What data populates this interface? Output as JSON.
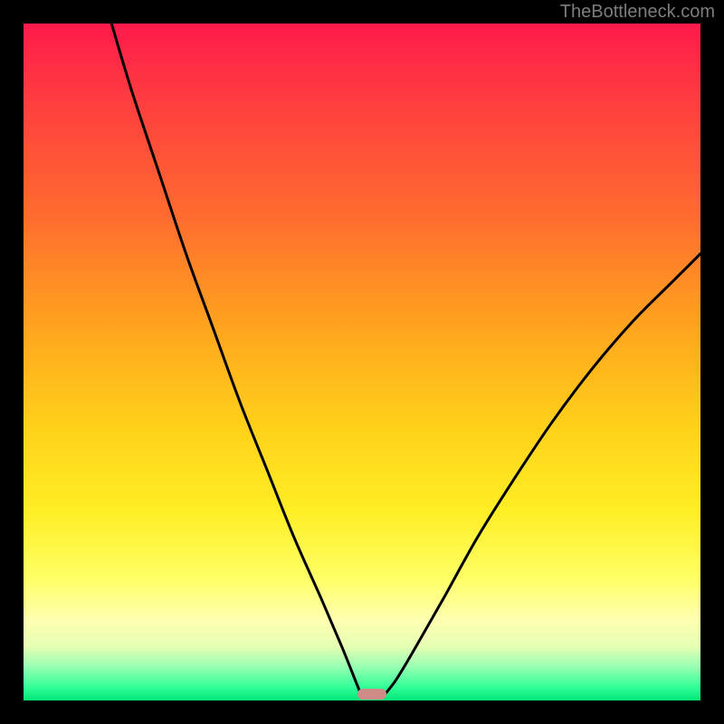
{
  "attribution": {
    "text": "TheBottleneck.com"
  },
  "chart_data": {
    "type": "line",
    "title": "",
    "xlabel": "",
    "ylabel": "",
    "xlim": [
      0,
      100
    ],
    "ylim": [
      0,
      100
    ],
    "grid": false,
    "series": [
      {
        "name": "left-branch",
        "x": [
          13.0,
          16.0,
          20.0,
          24.0,
          28.0,
          32.0,
          36.0,
          40.0,
          44.0,
          47.0,
          49.0,
          50.0
        ],
        "y": [
          100.0,
          90.0,
          78.0,
          66.0,
          55.0,
          44.0,
          34.0,
          24.0,
          15.0,
          8.0,
          3.0,
          0.5
        ]
      },
      {
        "name": "right-branch",
        "x": [
          53.0,
          55.0,
          58.0,
          62.0,
          67.0,
          72.0,
          78.0,
          84.0,
          90.0,
          96.0,
          100.0
        ],
        "y": [
          0.5,
          3.0,
          8.0,
          15.0,
          24.0,
          32.0,
          41.0,
          49.0,
          56.0,
          62.0,
          66.0
        ]
      }
    ],
    "marker": {
      "x_center_pct": 51.5,
      "y_pct": 0.9,
      "width_pct": 4.3,
      "height_pct": 1.6,
      "color": "#cf8b87"
    },
    "gradient_stops": [
      {
        "pct": 0,
        "color": "#ff1a4b"
      },
      {
        "pct": 28,
        "color": "#ff6a2f"
      },
      {
        "pct": 60,
        "color": "#ffd21a"
      },
      {
        "pct": 88,
        "color": "#ffffb0"
      },
      {
        "pct": 100,
        "color": "#00e676"
      }
    ]
  }
}
